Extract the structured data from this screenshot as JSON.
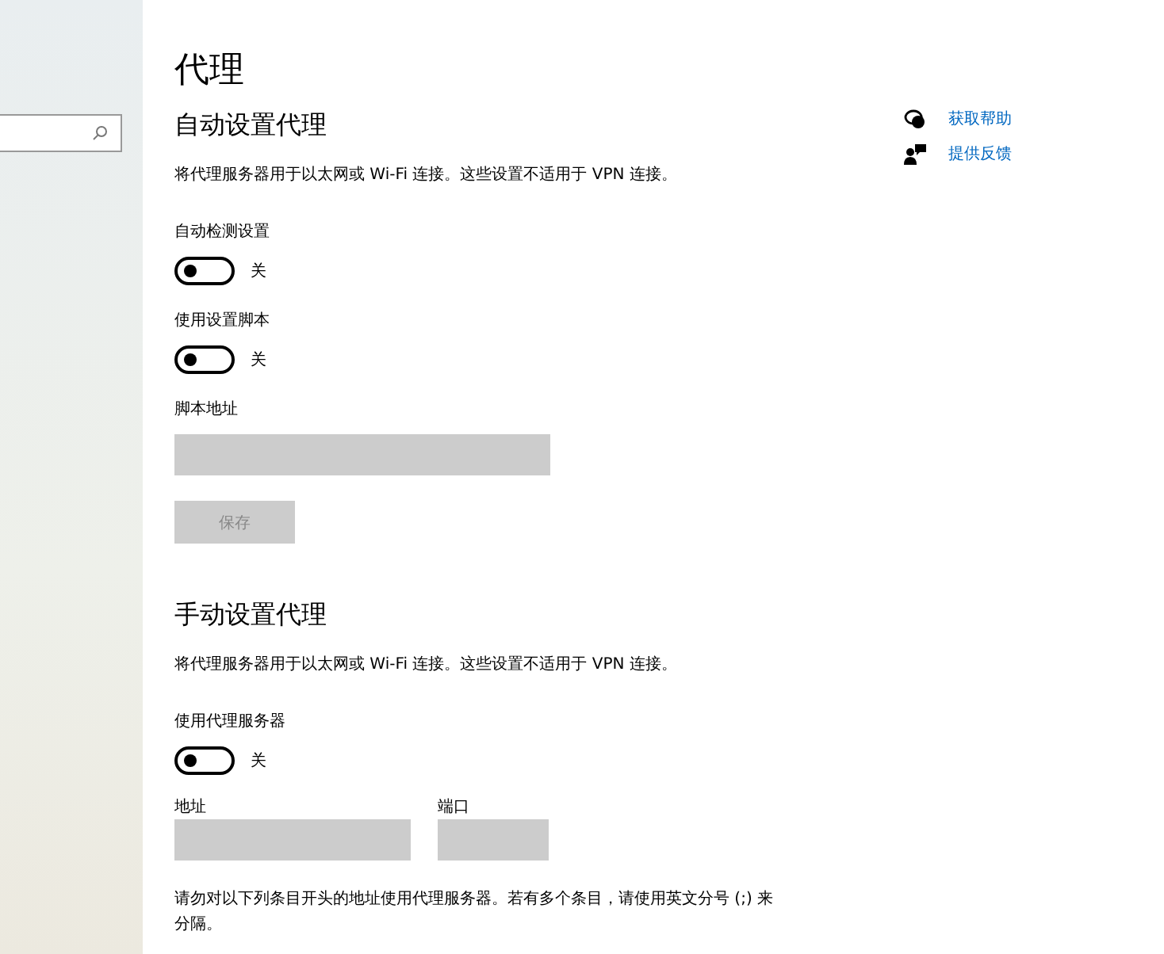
{
  "sidebar": {
    "search": {
      "kind": "field"
    }
  },
  "page": {
    "title": "代理"
  },
  "links": [
    {
      "label": "获取帮助"
    },
    {
      "label": "提供反馈"
    }
  ],
  "auto": {
    "heading": "自动设置代理",
    "description": "将代理服务器用于以太网或 Wi-Fi 连接。这些设置不适用于 VPN 连接。",
    "toggles": [
      {
        "label": "自动检测设置",
        "on": false,
        "state_text": "关"
      },
      {
        "label": "使用设置脚本",
        "on": false,
        "state_text": "关"
      }
    ],
    "script_address": {
      "label": "脚本地址"
    },
    "save_button": {
      "label": "保存",
      "disabled": true
    }
  },
  "manual": {
    "heading": "手动设置代理",
    "description": "将代理服务器用于以太网或 Wi-Fi 连接。这些设置不适用于 VPN 连接。",
    "toggle": {
      "label": "使用代理服务器",
      "on": false,
      "state_text": "关"
    },
    "address": {
      "label": "地址"
    },
    "port": {
      "label": "端口"
    },
    "exceptions_note": "请勿对以下列条目开头的地址使用代理服务器。若有多个条目，请使用英文分号 (;) 来分隔。"
  }
}
